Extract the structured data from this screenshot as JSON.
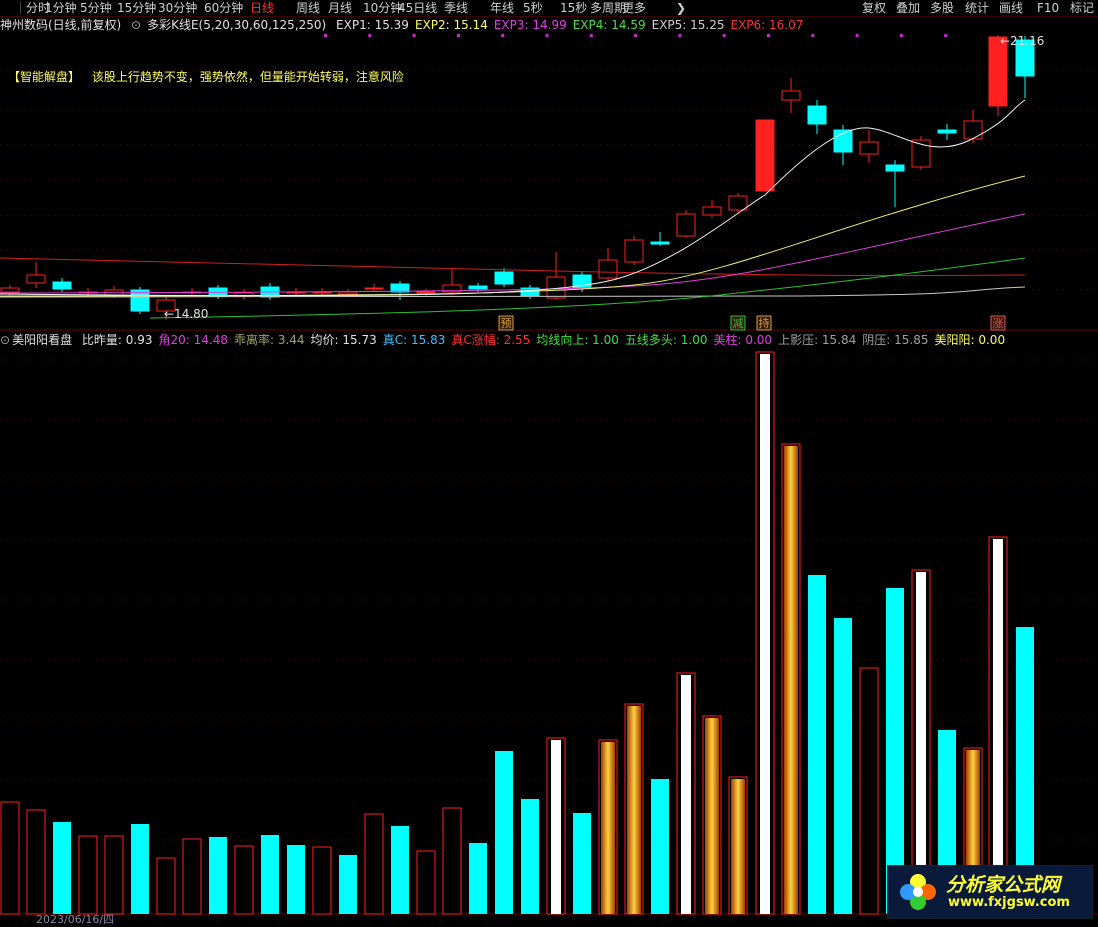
{
  "toolbar": {
    "periods": [
      "分时",
      "1分钟",
      "5分钟",
      "15分钟",
      "30分钟",
      "60分钟",
      "日线",
      "周线",
      "月线",
      "10分钟",
      "45日线",
      "季线",
      "年线",
      "5秒",
      "15秒",
      "多周期",
      "更多"
    ],
    "active_index": 6,
    "more_arrow": "❯",
    "right_items": [
      "复权",
      "叠加",
      "多股",
      "统计",
      "画线",
      "F10",
      "标记"
    ]
  },
  "price_panel": {
    "stock_name": "神州数码(日线,前复权)",
    "indicator_name": "多彩K线E(5,20,30,60,125,250)",
    "exp": [
      {
        "label": "EXP1: 15.39",
        "color": "#e0e0e0"
      },
      {
        "label": "EXP2: 15.14",
        "color": "#ffff60"
      },
      {
        "label": "EXP3: 14.99",
        "color": "#e040e0"
      },
      {
        "label": "EXP4: 14.59",
        "color": "#40e040"
      },
      {
        "label": "EXP5: 15.25",
        "color": "#d0d0d0"
      },
      {
        "label": "EXP6: 16.07",
        "color": "#ff3030"
      }
    ],
    "ai_tag": "【智能解盘】",
    "ai_text": "该股上行趋势不变，强势依然，但量能开始转弱，注意风险",
    "low_label": "←14.80",
    "high_label": "←21.16",
    "signals": [
      "预",
      "减",
      "持",
      "涨"
    ]
  },
  "volume_panel": {
    "indicator_name": "美阳阳看盘",
    "items": [
      {
        "label": "比昨量: 0.93",
        "color": "#e0e0e0"
      },
      {
        "label": "角20: 14.48",
        "color": "#e040e0"
      },
      {
        "label": "乖离率: 3.44",
        "color": "#a0a070"
      },
      {
        "label": "均价: 15.73",
        "color": "#e0e0e0"
      },
      {
        "label": "真C: 15.83",
        "color": "#40c0ff"
      },
      {
        "label": "真C涨幅: 2.55",
        "color": "#ff3030"
      },
      {
        "label": "均线向上: 1.00",
        "color": "#40e040"
      },
      {
        "label": "五线多头: 1.00",
        "color": "#40e040"
      },
      {
        "label": "美柱: 0.00",
        "color": "#e040e0"
      },
      {
        "label": "上影压: 15.84",
        "color": "#a0a0a0"
      },
      {
        "label": "阴压: 15.85",
        "color": "#a0a0a0"
      },
      {
        "label": "美阳阳: 0.00",
        "color": "#ffff60"
      }
    ]
  },
  "bottom_date": "2023/06/16/四",
  "watermark": {
    "title": "分析家公式网",
    "url": "www.fxjgsw.com"
  },
  "colors": {
    "up": "#ff2020",
    "down": "#00ffff",
    "background": "#000000",
    "grid": "#3a0000"
  }
}
